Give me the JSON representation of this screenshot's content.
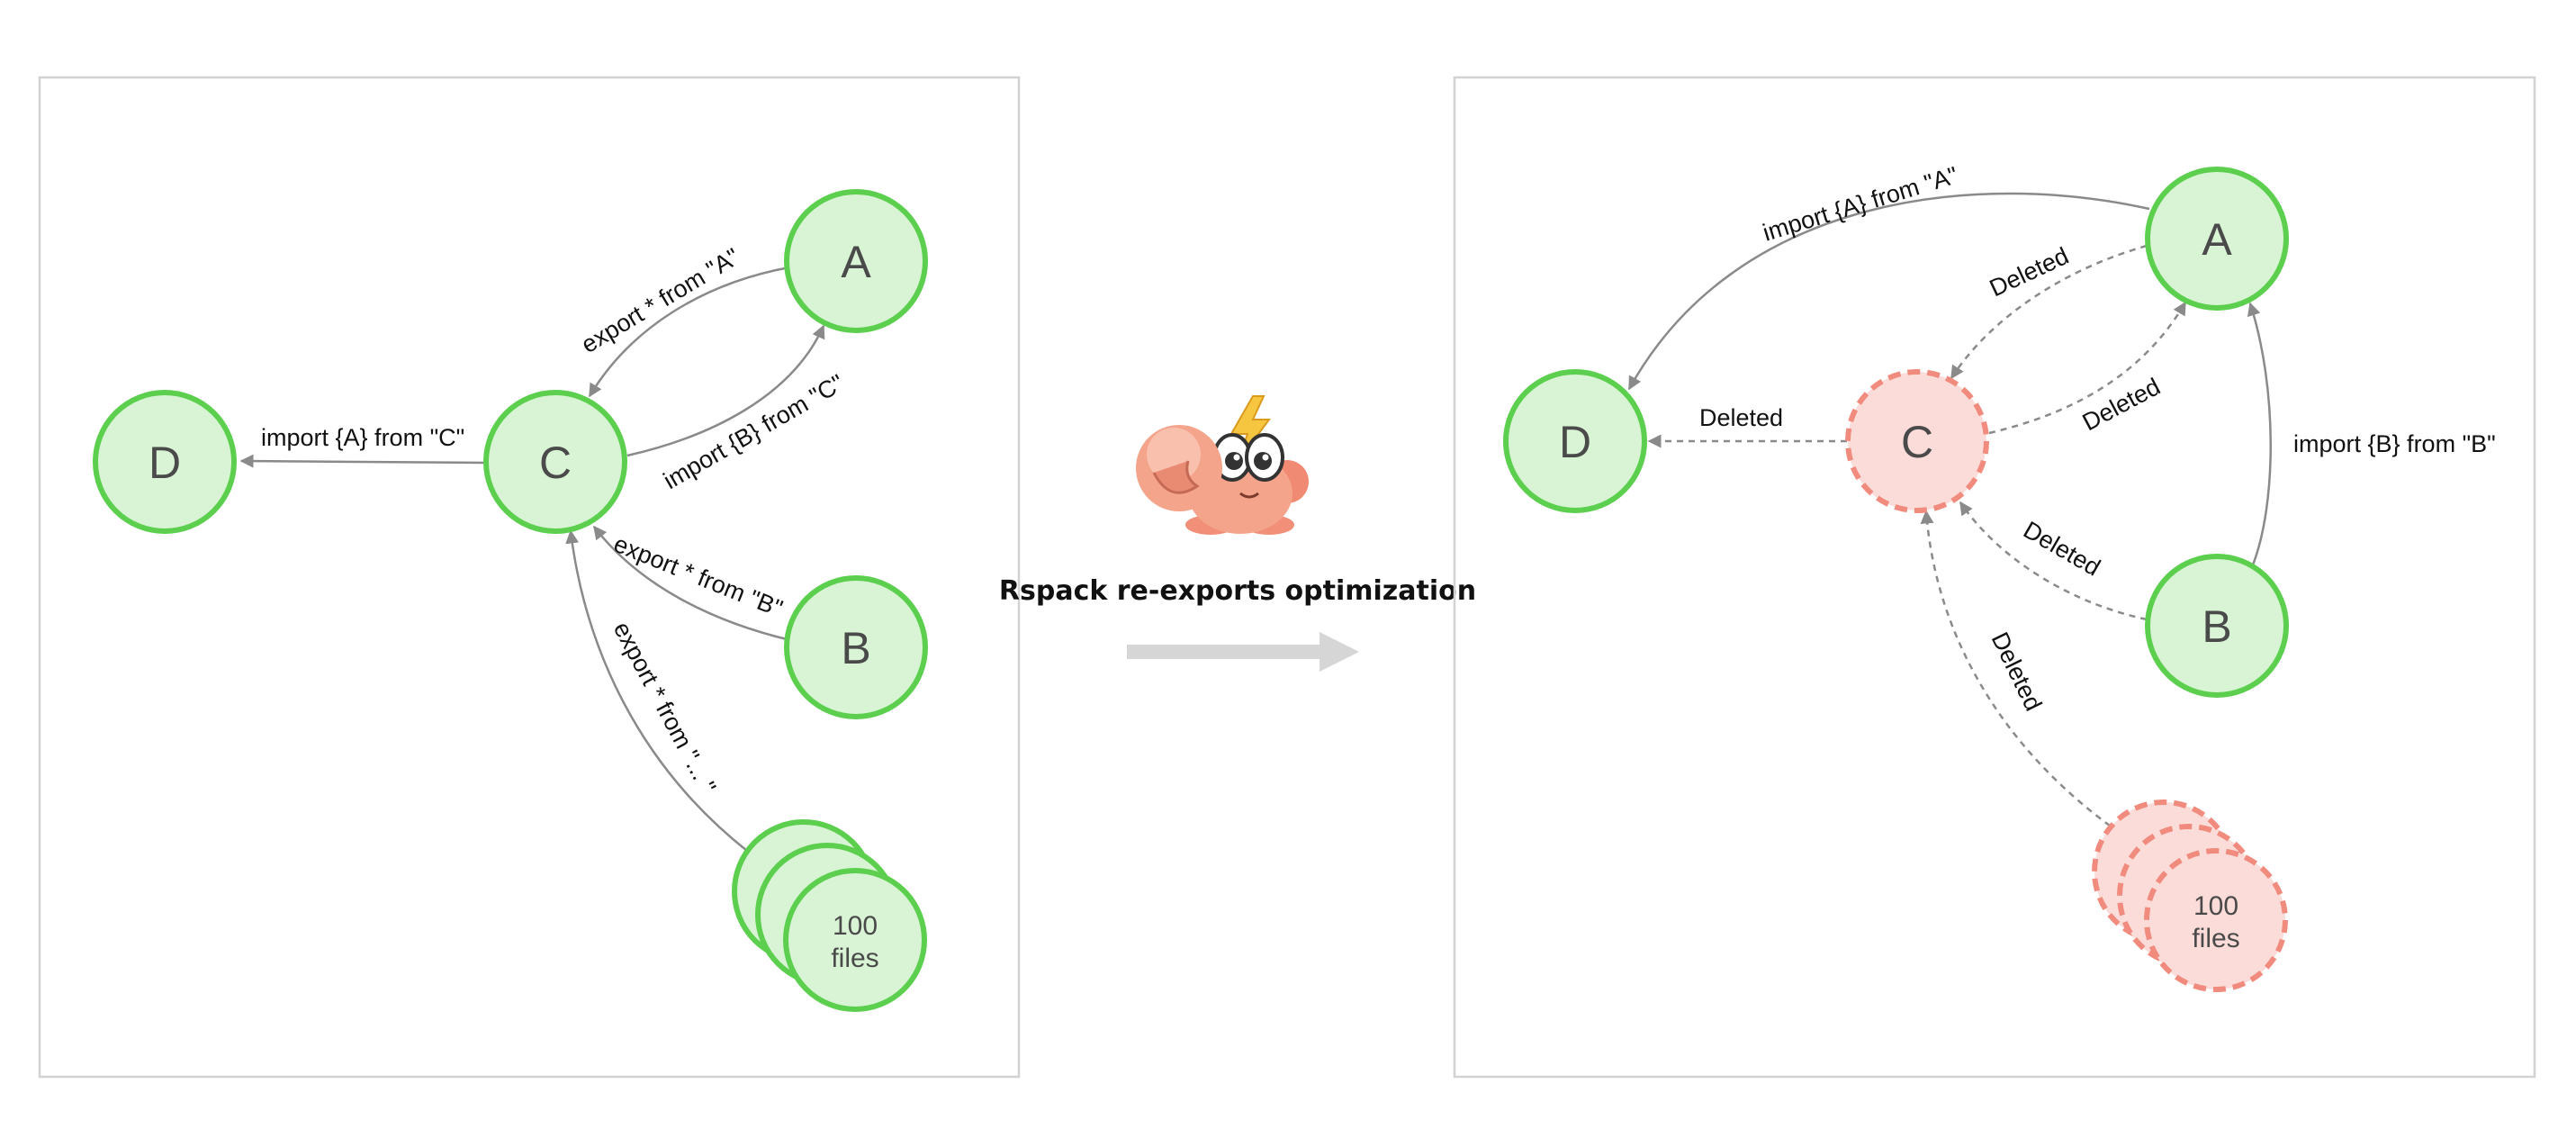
{
  "caption": "Rspack re-exports optimization",
  "before": {
    "nodes": {
      "A": "A",
      "B": "B",
      "C": "C",
      "D": "D",
      "files_line1": "100",
      "files_line2": "files"
    },
    "edges": {
      "c_to_d": "import {A} from \"C\"",
      "a_to_c": "export * from \"A\"",
      "c_to_a": "import {B} from \"C\"",
      "b_to_c": "export * from \"B\"",
      "files_to_c": "export * from \"... \""
    }
  },
  "after": {
    "nodes": {
      "A": "A",
      "B": "B",
      "C": "C",
      "D": "D",
      "files_line1": "100",
      "files_line2": "files"
    },
    "edges": {
      "a_to_d": "import {A} from \"A\"",
      "a_to_c": "Deleted",
      "c_to_a": "Deleted",
      "c_to_d": "Deleted",
      "b_to_c": "Deleted",
      "files_to_c": "Deleted",
      "b_to_a": "import {B} from \"B\""
    }
  },
  "colors": {
    "active_fill": "#d8f4d4",
    "active_stroke": "#5ccf4f",
    "deleted_fill": "#fbdcd9",
    "deleted_stroke": "#f08b7e",
    "edge": "#8a8a8a",
    "panel_border": "#d2d2d2",
    "arrow": "#d6d6d6"
  },
  "icons": [
    "rspack-crab-mascot",
    "transition-arrow"
  ]
}
